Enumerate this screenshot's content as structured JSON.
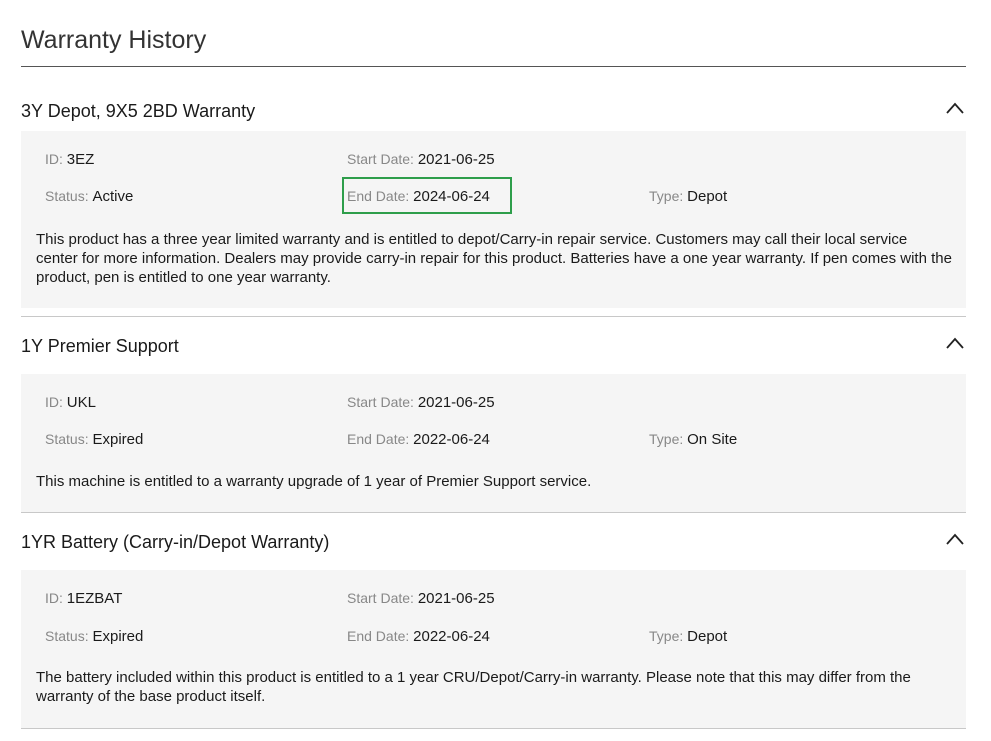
{
  "page": {
    "title": "Warranty History"
  },
  "warranties": [
    {
      "title": "3Y Depot, 9X5 2BD Warranty",
      "id_label": "ID",
      "id_value": "3EZ",
      "start_label": "Start Date",
      "start_value": "2021-06-25",
      "status_label": "Status",
      "status_value": "Active",
      "end_label": "End Date",
      "end_value": "2024-06-24",
      "type_label": "Type",
      "type_value": "Depot",
      "description": "This product has a three year limited warranty and is entitled to depot/Carry-in repair service. Customers may call their local service center for more information. Dealers may provide carry-in repair for this product. Batteries have a one year warranty. If pen comes with the product, pen is entitled to one year warranty."
    },
    {
      "title": "1Y Premier Support",
      "id_label": "ID",
      "id_value": "UKL",
      "start_label": "Start Date",
      "start_value": "2021-06-25",
      "status_label": "Status",
      "status_value": "Expired",
      "end_label": "End Date",
      "end_value": "2022-06-24",
      "type_label": "Type",
      "type_value": "On Site",
      "description": "This machine is entitled to a warranty upgrade of 1 year of Premier Support service."
    },
    {
      "title": "1YR Battery (Carry-in/Depot Warranty)",
      "id_label": "ID",
      "id_value": "1EZBAT",
      "start_label": "Start Date",
      "start_value": "2021-06-25",
      "status_label": "Status",
      "status_value": "Expired",
      "end_label": "End Date",
      "end_value": "2022-06-24",
      "type_label": "Type",
      "type_value": "Depot",
      "description": "The battery included within this product is entitled to a 1 year CRU/Depot/Carry-in warranty. Please note that this may differ from the warranty of the base product itself."
    }
  ],
  "icons": {
    "toggle": "chevron-up-icon"
  },
  "colors": {
    "highlight": "#2e9e4b",
    "panel_background": "#f5f5f5",
    "label": "#888888"
  }
}
